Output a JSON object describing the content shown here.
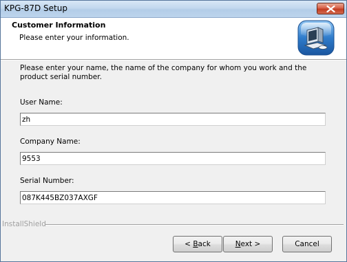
{
  "window": {
    "title": "KPG-87D Setup"
  },
  "header": {
    "title": "Customer Information",
    "subtitle": "Please enter your information.",
    "icon": "installer-computer-icon"
  },
  "body": {
    "instruction": "Please enter your name, the name of the company for whom you work and the product serial number."
  },
  "fields": {
    "user_name": {
      "label": "User Name:",
      "value": "zh"
    },
    "company_name": {
      "label": "Company Name:",
      "value": "9553"
    },
    "serial_number": {
      "label": "Serial Number:",
      "value": "087K445BZ037AXGF"
    }
  },
  "footer": {
    "brand": "InstallShield"
  },
  "buttons": {
    "back": {
      "prefix": "< ",
      "mnemonic": "B",
      "rest": "ack"
    },
    "next": {
      "mnemonic": "N",
      "rest": "ext >"
    },
    "cancel": {
      "label": "Cancel"
    }
  },
  "colors": {
    "close_button": "#c23d22",
    "titlebar": "#c2d8ee",
    "dialog_bg": "#f0f0f0"
  }
}
